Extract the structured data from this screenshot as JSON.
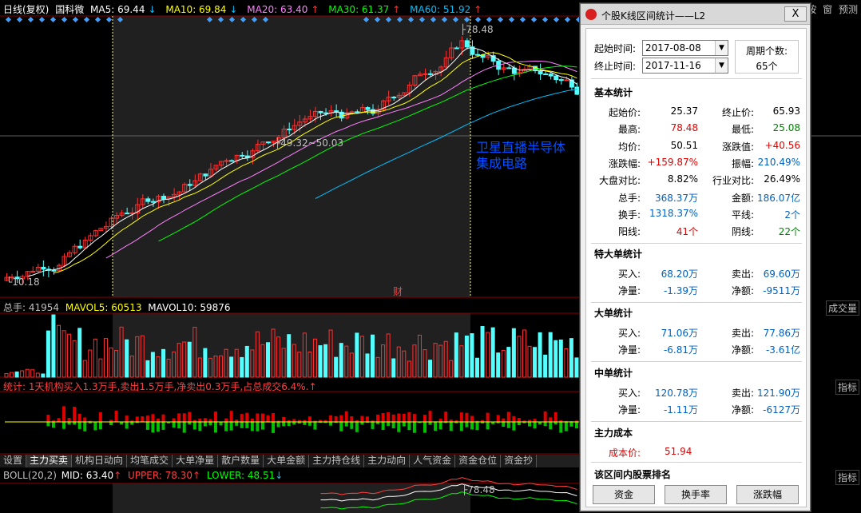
{
  "kline": {
    "title": "日线(复权)",
    "stock": "国科微",
    "ma5": "MA5: 69.44",
    "ma10": "MA10: 69.84",
    "ma20": "MA20: 63.40",
    "ma30": "MA30: 61.37",
    "ma60": "MA60: 51.92",
    "high_marker": "78.48",
    "low_marker": "10.18",
    "range_marker": "49.32~50.03",
    "annotation_line1": "卫星直播半导体",
    "annotation_line2": "集成电路",
    "cai_marker": "财",
    "colors": {
      "ma5": "#ffffff",
      "ma10": "#ffff00",
      "ma20": "#ff80ff",
      "ma30": "#00ff00",
      "ma60": "#00c0ff",
      "up": "#ff3030",
      "down": "#54ffff"
    }
  },
  "topbar": {
    "items": [
      "按",
      "窗",
      "预测"
    ]
  },
  "volume": {
    "total": "总手: 41954",
    "mavol5": "MAVOL5: 60513",
    "mavol10": "MAVOL10: 59876",
    "side_label": "成交量"
  },
  "stats_line": {
    "text": "统计: 1天机构买入1.3万手,卖出1.5万手,净卖出0.3万手,占总成交6.4%."
  },
  "side_labels": {
    "indicator1": "指标",
    "indicator2": "指标"
  },
  "tabs": [
    "设置",
    "主力买卖",
    "机构日动向",
    "均笔成交",
    "大单净量",
    "散户数量",
    "大单金额",
    "主力持仓线",
    "主力动向",
    "人气资金",
    "资金仓位",
    "资金抄"
  ],
  "boll": {
    "label": "BOLL(20,2)",
    "mid": "MID: 63.40",
    "upper": "UPPER: 78.30",
    "lower": "LOWER: 48.51",
    "high_marker": "78.48"
  },
  "dialog": {
    "title": "个股K线区间统计——L2",
    "close_label": "X",
    "start_label": "起始时间:",
    "start_value": "2017-08-08",
    "end_label": "终止时间:",
    "end_value": "2017-11-16",
    "period_label": "周期个数:",
    "period_value": "65个",
    "basic_title": "基本统计",
    "basic": [
      [
        "起始价:",
        "25.37",
        "终止价:",
        "65.93"
      ],
      [
        "最高:",
        "78.48",
        "最低:",
        "25.08"
      ],
      [
        "均价:",
        "50.51",
        "涨跌值:",
        "+40.56"
      ],
      [
        "涨跌幅:",
        "+159.87%",
        "振幅:",
        "210.49%"
      ],
      [
        "大盘对比:",
        "8.82%",
        "行业对比:",
        "26.49%"
      ],
      [
        "总手:",
        "368.37万",
        "金额:",
        "186.07亿"
      ],
      [
        "换手:",
        "1318.37%",
        "平线:",
        "2个"
      ],
      [
        "阳线:",
        "41个",
        "阴线:",
        "22个"
      ]
    ],
    "super_title": "特大单统计",
    "super": [
      [
        "买入:",
        "68.20万",
        "卖出:",
        "69.60万"
      ],
      [
        "净量:",
        "-1.39万",
        "净额:",
        "-9511万"
      ]
    ],
    "large_title": "大单统计",
    "large": [
      [
        "买入:",
        "71.06万",
        "卖出:",
        "77.86万"
      ],
      [
        "净量:",
        "-6.81万",
        "净额:",
        "-3.61亿"
      ]
    ],
    "mid_title": "中单统计",
    "mid": [
      [
        "买入:",
        "120.78万",
        "卖出:",
        "121.90万"
      ],
      [
        "净量:",
        "-1.11万",
        "净额:",
        "-6127万"
      ]
    ],
    "cost_title": "主力成本",
    "cost_label": "成本价:",
    "cost_value": "51.94",
    "rank_title": "该区间内股票排名",
    "buttons": [
      "资金",
      "换手率",
      "涨跌幅"
    ]
  }
}
